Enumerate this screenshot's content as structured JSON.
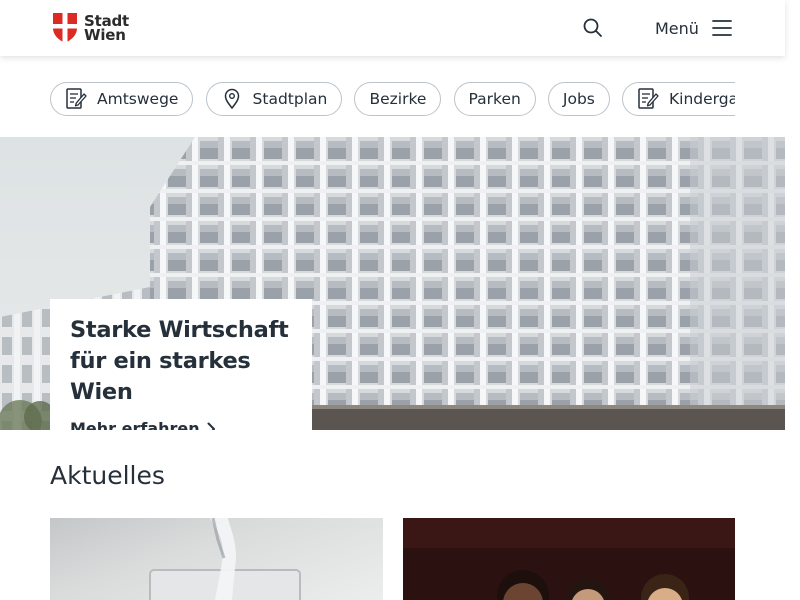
{
  "header": {
    "logo_line1": "Stadt",
    "logo_line2": "Wien",
    "search_icon": "search-icon",
    "menu_label": "Menü",
    "menu_icon": "hamburger-icon",
    "brand_color": "#dc2a25"
  },
  "quicklinks": [
    {
      "label": "Amtswege",
      "icon": "form-icon"
    },
    {
      "label": "Stadtplan",
      "icon": "map-pin-icon"
    },
    {
      "label": "Bezirke",
      "icon": ""
    },
    {
      "label": "Parken",
      "icon": ""
    },
    {
      "label": "Jobs",
      "icon": ""
    },
    {
      "label": "Kindergart",
      "icon": "form-icon"
    }
  ],
  "hero": {
    "title_line1": "Starke Wirtschaft",
    "title_line2": "für ein starkes Wien",
    "link_label": "Mehr erfahren",
    "link_icon": "chevron-right-icon"
  },
  "news": {
    "section_title": "Aktuelles"
  }
}
